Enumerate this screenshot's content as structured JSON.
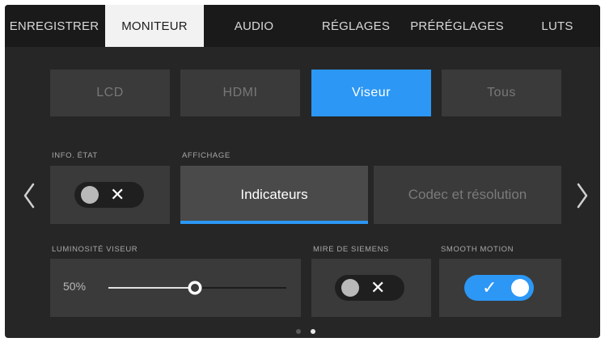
{
  "tabs": [
    {
      "label": "ENREGISTRER",
      "active": false
    },
    {
      "label": "MONITEUR",
      "active": true
    },
    {
      "label": "AUDIO",
      "active": false
    },
    {
      "label": "RÉGLAGES",
      "active": false
    },
    {
      "label": "PRÉRÉGLAGES",
      "active": false
    },
    {
      "label": "LUTS",
      "active": false
    }
  ],
  "outputs": [
    {
      "label": "LCD",
      "active": false
    },
    {
      "label": "HDMI",
      "active": false
    },
    {
      "label": "Viseur",
      "active": true
    },
    {
      "label": "Tous",
      "active": false
    }
  ],
  "info_etat": {
    "label": "INFO. ÉTAT",
    "state": "off",
    "mark": "✕"
  },
  "affichage": {
    "label": "AFFICHAGE",
    "options": [
      {
        "label": "Indicateurs",
        "active": true
      },
      {
        "label": "Codec et résolution",
        "active": false
      }
    ]
  },
  "luminosite": {
    "label": "LUMINOSITÉ VISEUR",
    "value_text": "50%",
    "value": 0.5
  },
  "mire_siemens": {
    "label": "MIRE DE SIEMENS",
    "state": "off",
    "mark": "✕"
  },
  "smooth_motion": {
    "label": "SMOOTH MOTION",
    "state": "on",
    "mark": "✓"
  },
  "pagination": {
    "pages": 2,
    "current": 2
  },
  "colors": {
    "accent": "#2c97f5",
    "panel": "#3a3a3a",
    "background": "#262626"
  }
}
